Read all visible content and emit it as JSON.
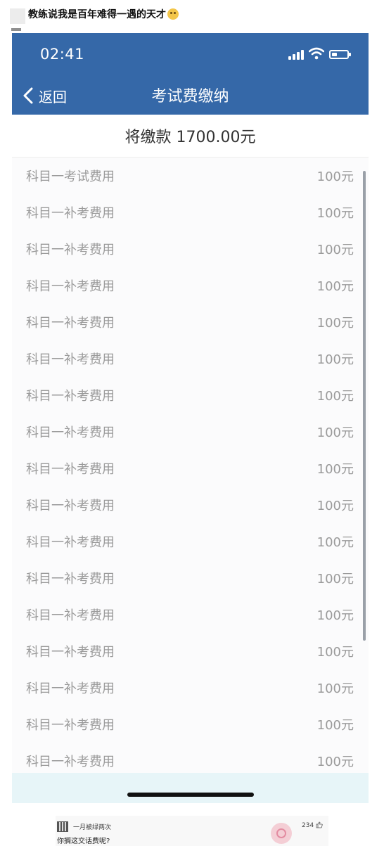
{
  "post": {
    "title": "教练说我是百年难得一遇的天才"
  },
  "status_bar": {
    "time": "02:41"
  },
  "nav": {
    "back_label": "返回",
    "title": "考试费缴纳"
  },
  "summary": {
    "amount_text": "将缴款 1700.00元"
  },
  "items": [
    {
      "label": "科目一考试费用",
      "amount": "100元"
    },
    {
      "label": "科目一补考费用",
      "amount": "100元"
    },
    {
      "label": "科目一补考费用",
      "amount": "100元"
    },
    {
      "label": "科目一补考费用",
      "amount": "100元"
    },
    {
      "label": "科目一补考费用",
      "amount": "100元"
    },
    {
      "label": "科目一补考费用",
      "amount": "100元"
    },
    {
      "label": "科目一补考费用",
      "amount": "100元"
    },
    {
      "label": "科目一补考费用",
      "amount": "100元"
    },
    {
      "label": "科目一补考费用",
      "amount": "100元"
    },
    {
      "label": "科目一补考费用",
      "amount": "100元"
    },
    {
      "label": "科目一补考费用",
      "amount": "100元"
    },
    {
      "label": "科目一补考费用",
      "amount": "100元"
    },
    {
      "label": "科目一补考费用",
      "amount": "100元"
    },
    {
      "label": "科目一补考费用",
      "amount": "100元"
    },
    {
      "label": "科目一补考费用",
      "amount": "100元"
    },
    {
      "label": "科目一补考费用",
      "amount": "100元"
    },
    {
      "label": "科目一补考费用",
      "amount": "100元"
    }
  ],
  "comment": {
    "username": "一月被绿两次",
    "text": "你搁这交话费呢?",
    "likes": "234"
  },
  "colors": {
    "app_bar": "#3568a8",
    "list_text": "#9a9a9a",
    "bottom_strip": "#e7f5f8"
  }
}
